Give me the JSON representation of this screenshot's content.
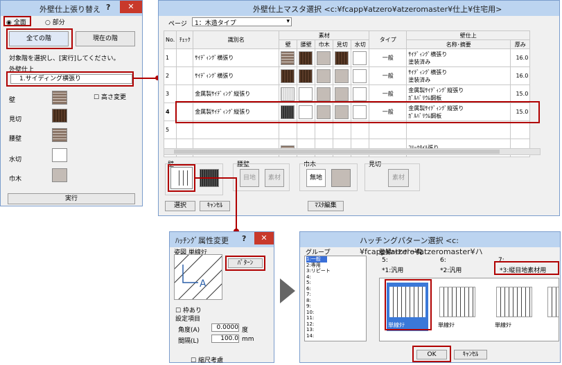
{
  "dlg1": {
    "title": "外壁仕上張り替え",
    "radio_all": "全面",
    "radio_part": "部分",
    "btn_all_floors": "全ての階",
    "btn_current_floor": "現在の階",
    "instruction": "対象階を選択し、[実行]してください。",
    "group_label": "外壁仕上",
    "selected_item": "1.サイディング横張り",
    "parts": [
      "壁",
      "見切",
      "腰壁",
      "水切",
      "巾木"
    ],
    "height_change": "高さ変更",
    "execute": "実行"
  },
  "dlg2": {
    "title": "外壁仕上マスタ選択 <c:¥fcapp¥atzero¥atzeromaster¥仕上¥住宅用>",
    "page_label": "ページ",
    "page_value": "1：木造タイプ",
    "headers": {
      "no": "No.",
      "check": "ﾁｪｯｸ",
      "name": "識別名",
      "material": "素材",
      "type": "タイプ",
      "finish": "壁仕上",
      "name_desc": "名称･摘要",
      "thickness": "厚み",
      "mat_cols": [
        "壁",
        "腰壁",
        "巾木",
        "見切",
        "水切"
      ]
    },
    "rows": [
      {
        "no": "1",
        "name": "ｻｲﾃﾞｨﾝｸﾞ横張り",
        "type": "一般",
        "desc1": "ｻｲﾃﾞｨﾝｸﾞ横張り",
        "desc2": "塗装済み",
        "thickness": "16.0"
      },
      {
        "no": "2",
        "name": "ｻｲﾃﾞｨﾝｸﾞ横張り",
        "type": "一般",
        "desc1": "ｻｲﾃﾞｨﾝｸﾞ横張り",
        "desc2": "塗装済み",
        "thickness": "16.0"
      },
      {
        "no": "3",
        "name": "金属製ｻｲﾃﾞｨﾝｸﾞ縦張り",
        "type": "一般",
        "desc1": "金属製ｻｲﾃﾞｨﾝｸﾞ縦張り",
        "desc2": "ｶﾞﾙﾊﾞﾘｳﾑ鋼板",
        "thickness": "15.0"
      },
      {
        "no": "4",
        "name": "金属製ｻｲﾃﾞｨﾝｸﾞ縦張り",
        "type": "一般",
        "desc1": "金属製ｻｲﾃﾞｨﾝｸﾞ縦張り",
        "desc2": "ｶﾞﾙﾊﾞﾘｳﾑ鋼板",
        "thickness": "15.0"
      },
      {
        "no": "5",
        "name": "",
        "type": "",
        "desc1": "",
        "desc2": "",
        "thickness": ""
      },
      {
        "no": "",
        "name": "",
        "type": "",
        "desc1": "ﾌﾘｯｸﾀｲﾙ張り",
        "desc2": "",
        "thickness": ""
      }
    ],
    "sec_wall": "壁",
    "sec_koshi": "腰壁",
    "koshi_joint": "目地",
    "koshi_mat": "素材",
    "sec_haba": "巾木",
    "haba_none": "無地",
    "sec_mikiri": "見切",
    "mikiri_mat": "素材",
    "btn_select": "選択",
    "btn_cancel": "ｷｬﾝｾﾙ",
    "btn_master": "ﾏｽﾀ編集"
  },
  "dlg3": {
    "title": "ﾊｯﾁﾝｸﾞ属性変更",
    "preview_label": "姿図",
    "preview_value": "単線ﾀﾃ",
    "btn_pattern": "ﾊﾟﾀｰﾝ",
    "frame_check": "枠あり",
    "settings": "設定項目",
    "angle_label": "角度(A)",
    "angle_value": "0.0000",
    "angle_unit": "度",
    "interval_label": "間隔(L)",
    "interval_value": "100.0",
    "interval_unit": "mm",
    "scale_check": "縮尺考慮"
  },
  "dlg4": {
    "title": "ハッチングパターン選択 <c:¥fcapp¥atzero¥atzeromaster¥ハ",
    "group_label": "グループ",
    "groups": [
      "1:一般",
      "2:専用",
      "3:リピート",
      "4:",
      "5:",
      "6:",
      "7:",
      "8:",
      "9:",
      "10:",
      "11:",
      "12:",
      "13:",
      "14:"
    ],
    "registered_label": "登録ﾊｯﾁﾝｸﾞ一覧",
    "col_nums": [
      "5:",
      "6:",
      "7:"
    ],
    "col_names": [
      "*1:汎用",
      "*2:汎用",
      "*3:縦目地素材用"
    ],
    "pattern_label": "単線ﾀﾃ",
    "ok": "OK",
    "cancel": "ｷｬﾝｾﾙ"
  },
  "colors": {
    "red_highlight": "#b00000",
    "title_bar": "#bcd4f0",
    "close_button": "#c8392b"
  }
}
